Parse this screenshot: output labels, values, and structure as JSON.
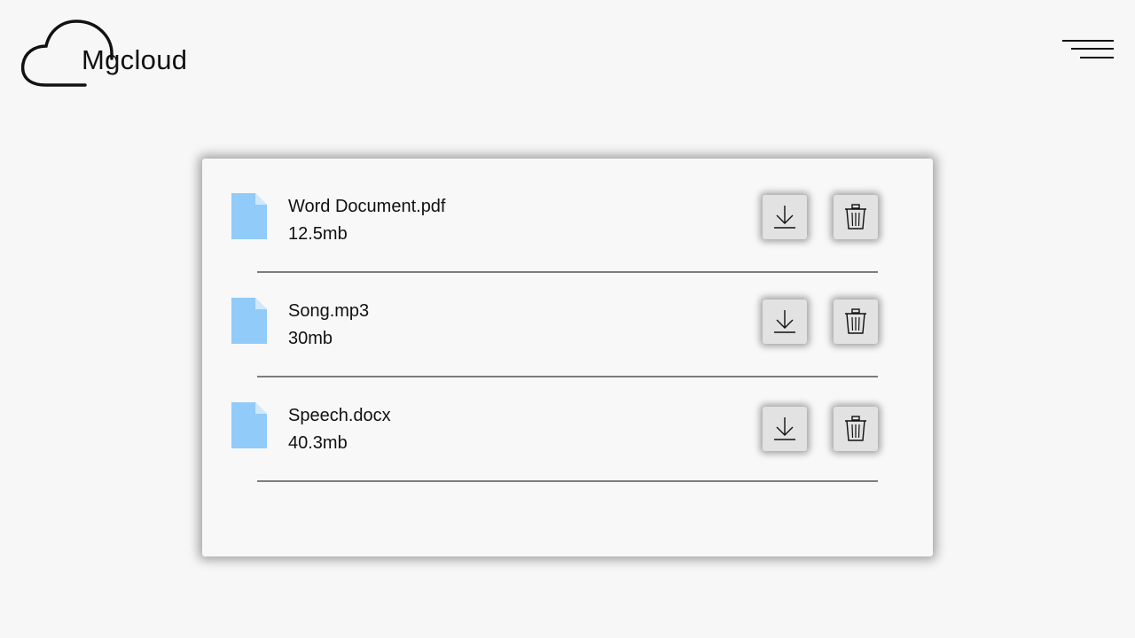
{
  "app": {
    "brand": "Mgcloud"
  },
  "header": {
    "menu_icon": "hamburger-menu-icon"
  },
  "colors": {
    "background": "#f7f7f7",
    "file_icon": "#90cbf9",
    "file_icon_fold": "#cfe8fd",
    "button_bg": "#e2e2e2",
    "divider": "#7d7d7d"
  },
  "files": [
    {
      "name": "Word Document.pdf",
      "size": "12.5mb",
      "icon": "file-icon",
      "download_icon": "download-icon",
      "delete_icon": "trash-icon"
    },
    {
      "name": "Song.mp3",
      "size": "30mb",
      "icon": "file-icon",
      "download_icon": "download-icon",
      "delete_icon": "trash-icon"
    },
    {
      "name": "Speech.docx",
      "size": "40.3mb",
      "icon": "file-icon",
      "download_icon": "download-icon",
      "delete_icon": "trash-icon"
    }
  ]
}
